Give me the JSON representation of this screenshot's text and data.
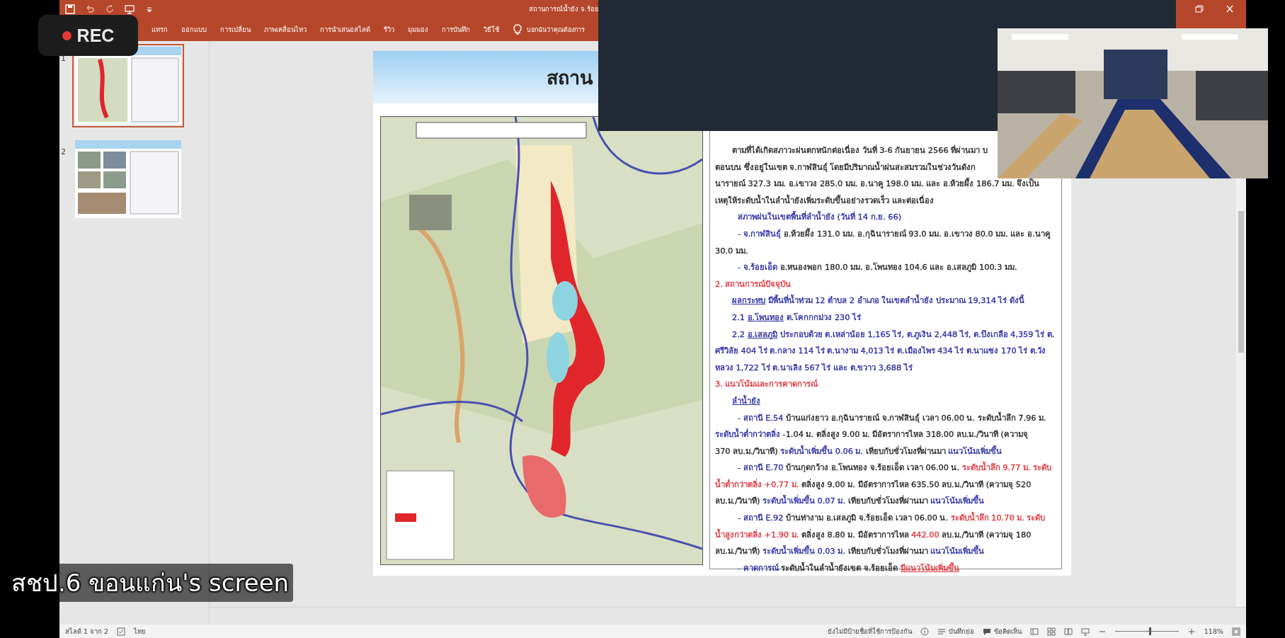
{
  "window": {
    "title": "สถานการณ์น้ำยัง จ.ร้อย"
  },
  "ribbon_tabs": [
    {
      "label": "แทรก"
    },
    {
      "label": "ออกแบบ"
    },
    {
      "label": "การเปลี่ยน"
    },
    {
      "label": "ภาพเคลื่อนไหว"
    },
    {
      "label": "การนำเสนอสไลด์"
    },
    {
      "label": "รีวิว"
    },
    {
      "label": "มุมมอง"
    },
    {
      "label": "การบันทึก"
    },
    {
      "label": "วิธีใช้"
    }
  ],
  "tell_me": {
    "placeholder": "บอกฉันว่าคุณต้องการ"
  },
  "recording": {
    "label": "REC"
  },
  "thumbnails": [
    {
      "number": "1",
      "selected": true
    },
    {
      "number": "2",
      "selected": false
    }
  ],
  "slide": {
    "title": "สถาน",
    "lines": [
      {
        "kind": "para",
        "parts": [
          {
            "text": "ตามที่ได้เกิดสภาวะฝนตกหนักต่อเนื่อง วันที่ 3-6 กันยายน 2566 ที่ผ่านมา บ",
            "color": "#2a2a2a"
          }
        ]
      },
      {
        "kind": "cont",
        "parts": [
          {
            "text": "ตอนบน ซึ่งอยู่ในเขต จ.กาฬสินธุ์ โดยมีปริมาณน้ำฝนสะสมรวมในช่วงวันดังก",
            "color": "#2a2a2a"
          }
        ]
      },
      {
        "kind": "cont",
        "parts": [
          {
            "text": "นารายณ์ 327.3 มม. อ.เขาวง 285.0 มม. อ.นาคู 198.0 มม. และ อ.ห้วยผึ้ง 186.7 มม. จึงเป็น",
            "color": "#2a2a2a"
          }
        ]
      },
      {
        "kind": "cont",
        "parts": [
          {
            "text": "เหตุให้ระดับน้ำในลำน้ำยังเพิ่มระดับขึ้นอย่างรวดเร็ว และต่อเนื่อง",
            "color": "#2a2a2a"
          }
        ]
      },
      {
        "kind": "sub",
        "parts": [
          {
            "text": "สภาพฝนในเขตพื้นที่ลำน้ำยัง  (วันที่  14 ก.ย. 66)",
            "color": "#2c2fa6"
          }
        ]
      },
      {
        "kind": "sub",
        "parts": [
          {
            "text": "- จ.กาฬสินธุ์",
            "color": "#2c2fa6"
          },
          {
            "text": "  อ.ห้วยผึ้ง 131.0 มม. อ.กุฉินารายณ์ 93.0 มม. อ.เขาวง 80.0 มม. และ อ.นาคู",
            "color": "#2a2a2a"
          }
        ]
      },
      {
        "kind": "cont",
        "parts": [
          {
            "text": "30.0 มม.",
            "color": "#2a2a2a"
          }
        ]
      },
      {
        "kind": "sub",
        "parts": [
          {
            "text": "- จ.ร้อยเอ็ด",
            "color": "#2c2fa6"
          },
          {
            "text": " อ.หนองพอก 180.0 มม. อ.โพนทอง 104.6  และ อ.เสลภูมิ 100.3 มม.",
            "color": "#2a2a2a"
          }
        ]
      },
      {
        "kind": "heading",
        "parts": [
          {
            "text": "2. สถานการณ์ปัจจุบัน",
            "color": "#e2363c"
          }
        ]
      },
      {
        "kind": "para",
        "parts": [
          {
            "text": "ผลกระทบ",
            "color": "#2c2fa6",
            "underline": true
          },
          {
            "text": "  มีพื้นที่น้ำท่วม 12 ตำบล 2 อำเภอ ในเขตลำน้ำยัง ประมาณ 19,314 ไร่ ดังนี้",
            "color": "#2c2fa6"
          }
        ]
      },
      {
        "kind": "para",
        "parts": [
          {
            "text": "2.1 ",
            "color": "#2c2fa6"
          },
          {
            "text": "อ.โพนทอง",
            "color": "#2c2fa6",
            "underline": true
          },
          {
            "text": " ต.โคกกกม่วง 230 ไร่",
            "color": "#2c2fa6"
          }
        ]
      },
      {
        "kind": "para",
        "parts": [
          {
            "text": "2.2 ",
            "color": "#2c2fa6"
          },
          {
            "text": "อ.เสลภูมิ",
            "color": "#2c2fa6",
            "underline": true
          },
          {
            "text": " ประกอบด้วย ต.เหล่าน้อย 1,165 ไร่, ต.ภูเงิน 2,448 ไร่, ต.บึงเกลือ 4,359 ไร่ ต.",
            "color": "#2c2fa6"
          }
        ]
      },
      {
        "kind": "cont",
        "parts": [
          {
            "text": "ศรีวิลัย 404 ไร่ ต.กลาง 114 ไร่ ต.นางาม 4,013 ไร่ ต.เมืองไพร 434 ไร่ ต.นาแซง 170 ไร่ ต.วัง",
            "color": "#2c2fa6"
          }
        ]
      },
      {
        "kind": "cont",
        "parts": [
          {
            "text": "หลวง 1,722 ไร่ ต.นาเลิง 567 ไร่ และ ต.ขวาว 3,688 ไร่",
            "color": "#2c2fa6"
          }
        ]
      },
      {
        "kind": "heading",
        "parts": [
          {
            "text": "3. แนวโน้มและการคาดการณ์",
            "color": "#e2363c"
          }
        ]
      },
      {
        "kind": "para",
        "parts": [
          {
            "text": "ลำน้ำยัง",
            "color": "#2c2fa6",
            "underline": true
          }
        ]
      },
      {
        "kind": "sub",
        "parts": [
          {
            "text": "- สถานี E.54",
            "color": "#2c2fa6"
          },
          {
            "text": " บ้านแก่งยาว อ.กุฉินารายณ์ จ.กาฬสินธุ์ เวลา 06.00 น. ระดับน้ำลึก 7.96 ม.",
            "color": "#2a2a2a"
          }
        ]
      },
      {
        "kind": "cont",
        "parts": [
          {
            "text": "ระดับน้ำต่ำกว่าตลิ่ง",
            "color": "#2c2fa6"
          },
          {
            "text": " -1.04 ม. ตลิ่งสูง 9.00 ม. มีอัตราการไหล 318.00 ลบ.ม./วินาที (ความจุ",
            "color": "#2a2a2a"
          }
        ]
      },
      {
        "kind": "cont",
        "parts": [
          {
            "text": "370 ลบ.ม./วินาที) ",
            "color": "#2a2a2a"
          },
          {
            "text": "ระดับน้ำเพิ่มขึ้น 0.06 ม.",
            "color": "#2c2fa6"
          },
          {
            "text": " เทียบกับชั่วโมงที่ผ่านมา ",
            "color": "#2a2a2a"
          },
          {
            "text": "แนวโน้มเพิ่มขึ้น",
            "color": "#2c2fa6"
          }
        ]
      },
      {
        "kind": "sub",
        "parts": [
          {
            "text": "- สถานี E.70",
            "color": "#2c2fa6"
          },
          {
            "text": " บ้านกุดกว้าง อ.โพนทอง จ.ร้อยเอ็ด เวลา 06.00 น. ",
            "color": "#2a2a2a"
          },
          {
            "text": "ระดับน้ำลึก 9.77 ม. ระดับ",
            "color": "#e2363c"
          }
        ]
      },
      {
        "kind": "cont",
        "parts": [
          {
            "text": "น้ำต่ำกว่าตลิ่ง +0.77 ม.",
            "color": "#e2363c"
          },
          {
            "text": " ตลิ่งสูง 9.00 ม. มีอัตราการไหล 635.50 ลบ.ม./วินาที (ความจุ 520",
            "color": "#2a2a2a"
          }
        ]
      },
      {
        "kind": "cont",
        "parts": [
          {
            "text": "ลบ.ม./วินาที) ",
            "color": "#2a2a2a"
          },
          {
            "text": "ระดับน้ำเพิ่มขึ้น 0.07 ม.",
            "color": "#2c2fa6"
          },
          {
            "text": " เทียบกับชั่วโมงที่ผ่านมา ",
            "color": "#2a2a2a"
          },
          {
            "text": "แนวโน้มเพิ่มขึ้น",
            "color": "#2c2fa6"
          }
        ]
      },
      {
        "kind": "sub",
        "parts": [
          {
            "text": "- สถานี E.92",
            "color": "#2c2fa6"
          },
          {
            "text": " บ้านท่างาม อ.เสลภูมิ จ.ร้อยเอ็ด เวลา 06.00 น. ",
            "color": "#2a2a2a"
          },
          {
            "text": "ระดับน้ำลึก 10.70 ม. ระดับ",
            "color": "#e2363c"
          }
        ]
      },
      {
        "kind": "cont",
        "parts": [
          {
            "text": "น้ำสูงกว่าตลิ่ง +1.90 ม.",
            "color": "#e2363c"
          },
          {
            "text": " ตลิ่งสูง 8.80 ม. มีอัตราการไหล ",
            "color": "#2a2a2a"
          },
          {
            "text": "442.00",
            "color": "#e2363c"
          },
          {
            "text": " ลบ.ม./วินาที (ความจุ 180",
            "color": "#2a2a2a"
          }
        ]
      },
      {
        "kind": "cont",
        "parts": [
          {
            "text": "ลบ.ม./วินาที) ",
            "color": "#2a2a2a"
          },
          {
            "text": "ระดับน้ำเพิ่มขึ้น 0.03 ม.",
            "color": "#2c2fa6"
          },
          {
            "text": " เทียบกับชั่วโมงที่ผ่านมา ",
            "color": "#2a2a2a"
          },
          {
            "text": "แนวโน้มเพิ่มขึ้น",
            "color": "#2c2fa6"
          }
        ]
      },
      {
        "kind": "sub",
        "parts": [
          {
            "text": "- คาดการณ์",
            "color": "#2c2fa6"
          },
          {
            "text": "  ระดับน้ำในลำน้ำยังเขต จ.ร้อยเอ็ด ",
            "color": "#2a2a2a"
          },
          {
            "text": "มีแนวโน้มเพิ่มขึ้น",
            "color": "#e2363c",
            "underline": true
          }
        ]
      }
    ]
  },
  "caption": "สชป.6 ขอนแก่น's screen",
  "status_bar": {
    "slide_counter": "สไลด์ 1 จาก 2",
    "language": "ไทย",
    "sensitivity": "ยังไม่มีป้ายชื่อที่ใช้การป้องกัน",
    "notes": "บันทึกย่อ",
    "comments": "ข้อคิดเห็น",
    "zoom": {
      "level": 0.53,
      "reading": "118%"
    }
  }
}
